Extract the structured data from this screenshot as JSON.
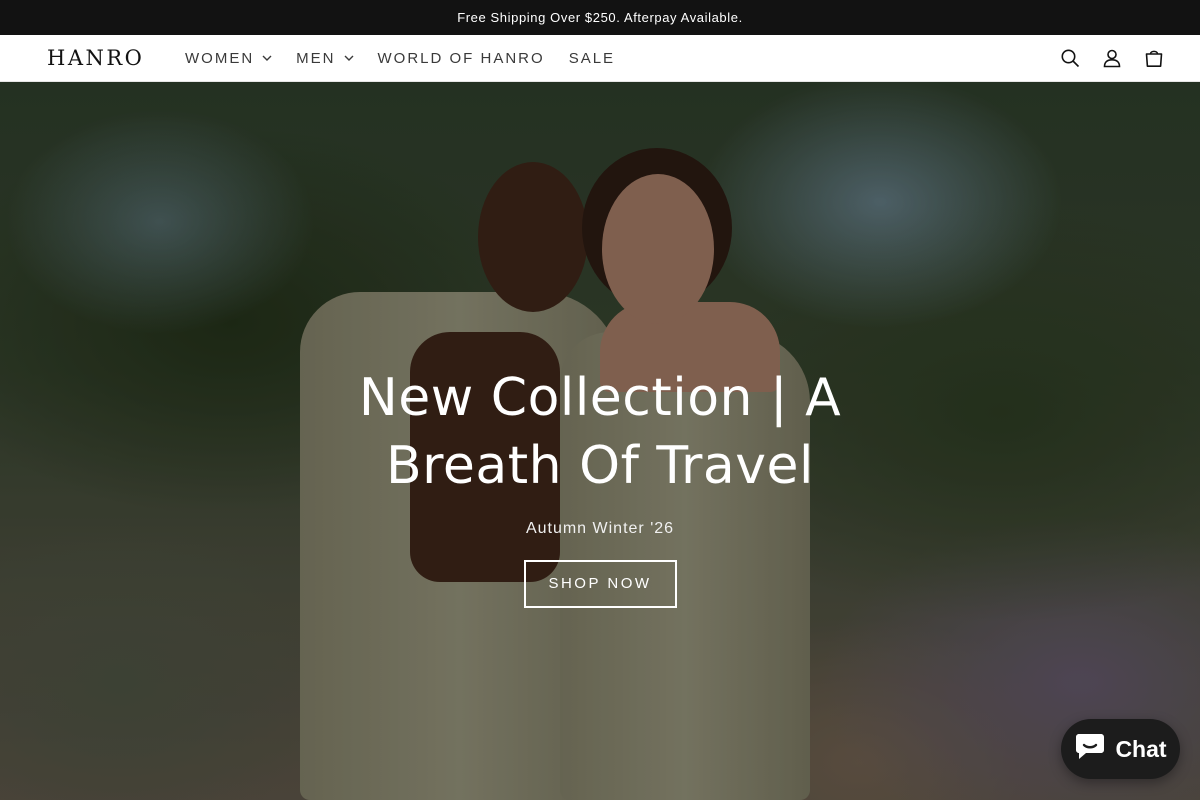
{
  "announcement": {
    "text": "Free Shipping Over $250. Afterpay Available."
  },
  "header": {
    "logo_text": "HANRO",
    "nav": [
      {
        "label": "WOMEN",
        "has_dropdown": true
      },
      {
        "label": "MEN",
        "has_dropdown": true
      },
      {
        "label": "WORLD OF HANRO",
        "has_dropdown": false
      },
      {
        "label": "SALE",
        "has_dropdown": false
      }
    ],
    "icons": [
      "search-icon",
      "account-icon",
      "cart-icon"
    ]
  },
  "hero": {
    "title": "New Collection | A Breath Of Travel",
    "subtitle": "Autumn Winter '26",
    "cta_label": "SHOP NOW"
  },
  "chat": {
    "label": "Chat",
    "icon": "chat-bubble-icon"
  },
  "colors": {
    "announcement_bg": "#121212",
    "text_white": "#ffffff",
    "chat_bg": "#1c1c1c"
  }
}
